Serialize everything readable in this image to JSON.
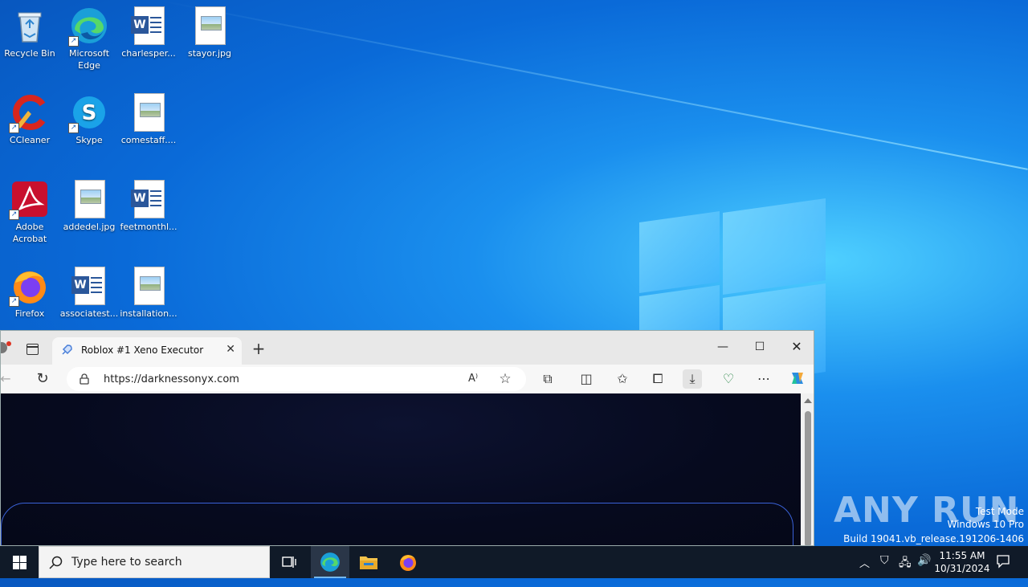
{
  "desktop": {
    "icons": [
      {
        "label": "Recycle Bin",
        "icon": "recycle-bin-icon"
      },
      {
        "label": "Microsoft Edge",
        "icon": "edge-icon"
      },
      {
        "label": "charlesper...",
        "icon": "word-document-icon"
      },
      {
        "label": "stayor.jpg",
        "icon": "image-file-icon"
      },
      {
        "label": "CCleaner",
        "icon": "ccleaner-icon"
      },
      {
        "label": "Skype",
        "icon": "skype-icon"
      },
      {
        "label": "comestaff....",
        "icon": "image-file-icon"
      },
      {
        "label": "Adobe Acrobat",
        "icon": "adobe-acrobat-icon"
      },
      {
        "label": "addedel.jpg",
        "icon": "image-file-icon"
      },
      {
        "label": "feetmonthl...",
        "icon": "word-document-icon"
      },
      {
        "label": "Firefox",
        "icon": "firefox-icon"
      },
      {
        "label": "associatest...",
        "icon": "word-document-icon"
      },
      {
        "label": "installation...",
        "icon": "image-file-icon"
      }
    ]
  },
  "browser": {
    "tab_title": "Roblox #1 Xeno Executor",
    "tab_close": "✕",
    "new_tab": "+",
    "url": "https://darknessonyx.com",
    "window_buttons": {
      "minimize": "—",
      "maximize": "☐",
      "close": "✕"
    }
  },
  "watermark": {
    "brand": "ANY RUN",
    "line1": "Test Mode",
    "line2": "Windows 10 Pro",
    "line3": "Build 19041.vb_release.191206-1406"
  },
  "taskbar": {
    "search_placeholder": "Type here to search",
    "time": "11:55 AM",
    "date": "10/31/2024"
  },
  "colors": {
    "desktop_blue": "#0a6ad8",
    "taskbar": "#101a28",
    "page_bg": "#060a1e",
    "card_border": "#3a62d8"
  }
}
